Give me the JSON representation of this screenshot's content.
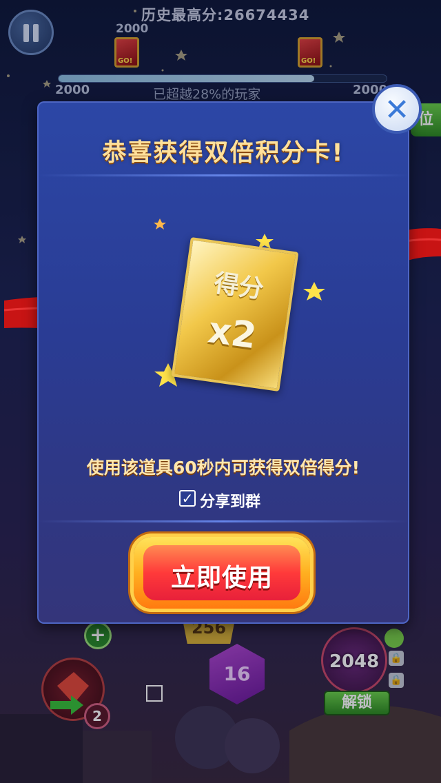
{
  "hud": {
    "high_score_label": "历史最高分:",
    "high_score_value": "26674434",
    "marker_top_score": "2000",
    "left_score": "2000",
    "right_score": "2000",
    "progress_text": "已超越28%的玩家",
    "progress_fraction": 0.78,
    "avatar_badge": "GO!"
  },
  "modal": {
    "title": "恭喜获得双倍积分卡!",
    "card_label": "得分",
    "card_multiplier": "x2",
    "description": "使用该道具60秒内可获得双倍得分!",
    "share_checked": true,
    "share_label": "分享到群",
    "use_button_label": "立即使用",
    "close_symbol": "✕"
  },
  "board": {
    "tile_256": "256",
    "tile_16": "16",
    "gem_2048": "2048",
    "unlock_label": "解锁",
    "item_count": "2",
    "side_button_label": "位"
  },
  "colors": {
    "modal_bg": "#2c47a6",
    "title_text": "#ffe09a",
    "ribbon": "#d01818",
    "button_orange": "#ffb020",
    "button_red": "#e8203a",
    "unlock_green": "#2e8a22"
  }
}
